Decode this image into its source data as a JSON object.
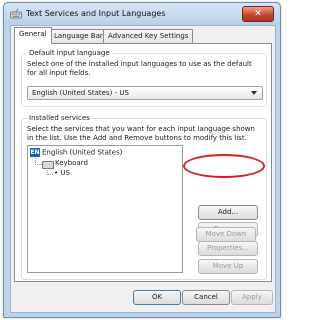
{
  "window": {
    "title": "Text Services and Input Languages",
    "close_glyph": "✕"
  },
  "tabs": [
    {
      "label": "General"
    },
    {
      "label": "Language Bar"
    },
    {
      "label": "Advanced Key Settings"
    }
  ],
  "default_input_language": {
    "legend": "Default input language",
    "description": "Select one of the installed input languages to use as the default for all input fields.",
    "selected": "English (United States) - US"
  },
  "installed_services": {
    "legend": "Installed services",
    "description": "Select the services that you want for each input language shown in the list. Use the Add and Remove buttons to modify this list.",
    "tree": {
      "language_badge": "EN",
      "language": "English (United States)",
      "category": "Keyboard",
      "layout": "US"
    },
    "buttons": {
      "add": "Add...",
      "remove": "Remove",
      "properties": "Properties...",
      "move_up": "Move Up",
      "move_down": "Move Down"
    }
  },
  "footer": {
    "ok": "OK",
    "cancel": "Cancel",
    "apply": "Apply"
  },
  "colors": {
    "highlight_circle": "#d21f1f",
    "language_badge": "#1a5fb4"
  }
}
